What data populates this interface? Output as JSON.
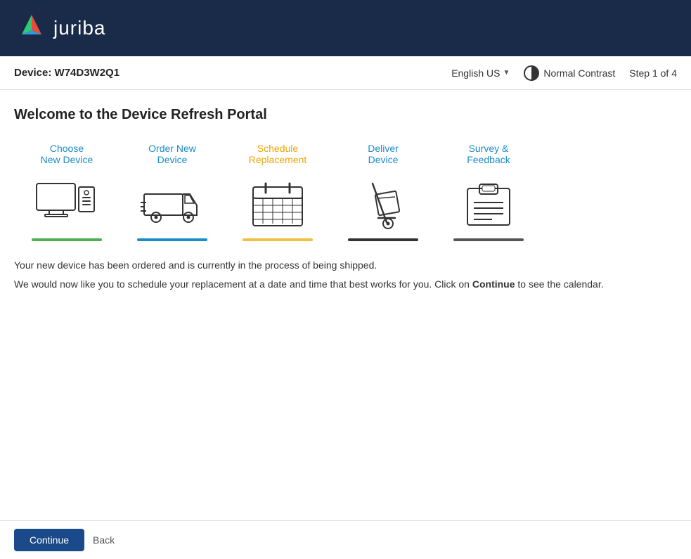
{
  "header": {
    "logo_text": "juriba",
    "device_label": "Device: W74D3W2Q1",
    "language": "English US",
    "contrast_label": "Normal Contrast",
    "step_label": "Step 1 of 4"
  },
  "main": {
    "welcome_title": "Welcome to the Device Refresh Portal",
    "info_line1": "Your new device has been ordered and is currently in the process of being shipped.",
    "info_line2_prefix": "We would now like you to schedule your replacement at a date and time that best works for you. Click on ",
    "info_line2_link": "Continue",
    "info_line2_suffix": " to see the calendar."
  },
  "steps": [
    {
      "label": "Choose\nNew Device",
      "underline_class": "underline-green",
      "id": "choose"
    },
    {
      "label": "Order New\nDevice",
      "underline_class": "underline-blue",
      "id": "order"
    },
    {
      "label": "Schedule\nReplacement",
      "underline_class": "underline-yellow",
      "id": "schedule"
    },
    {
      "label": "Deliver\nDevice",
      "underline_class": "underline-black",
      "id": "deliver"
    },
    {
      "label": "Survey &\nFeedback",
      "underline_class": "underline-dark",
      "id": "survey"
    }
  ],
  "footer": {
    "continue_label": "Continue",
    "back_label": "Back"
  }
}
